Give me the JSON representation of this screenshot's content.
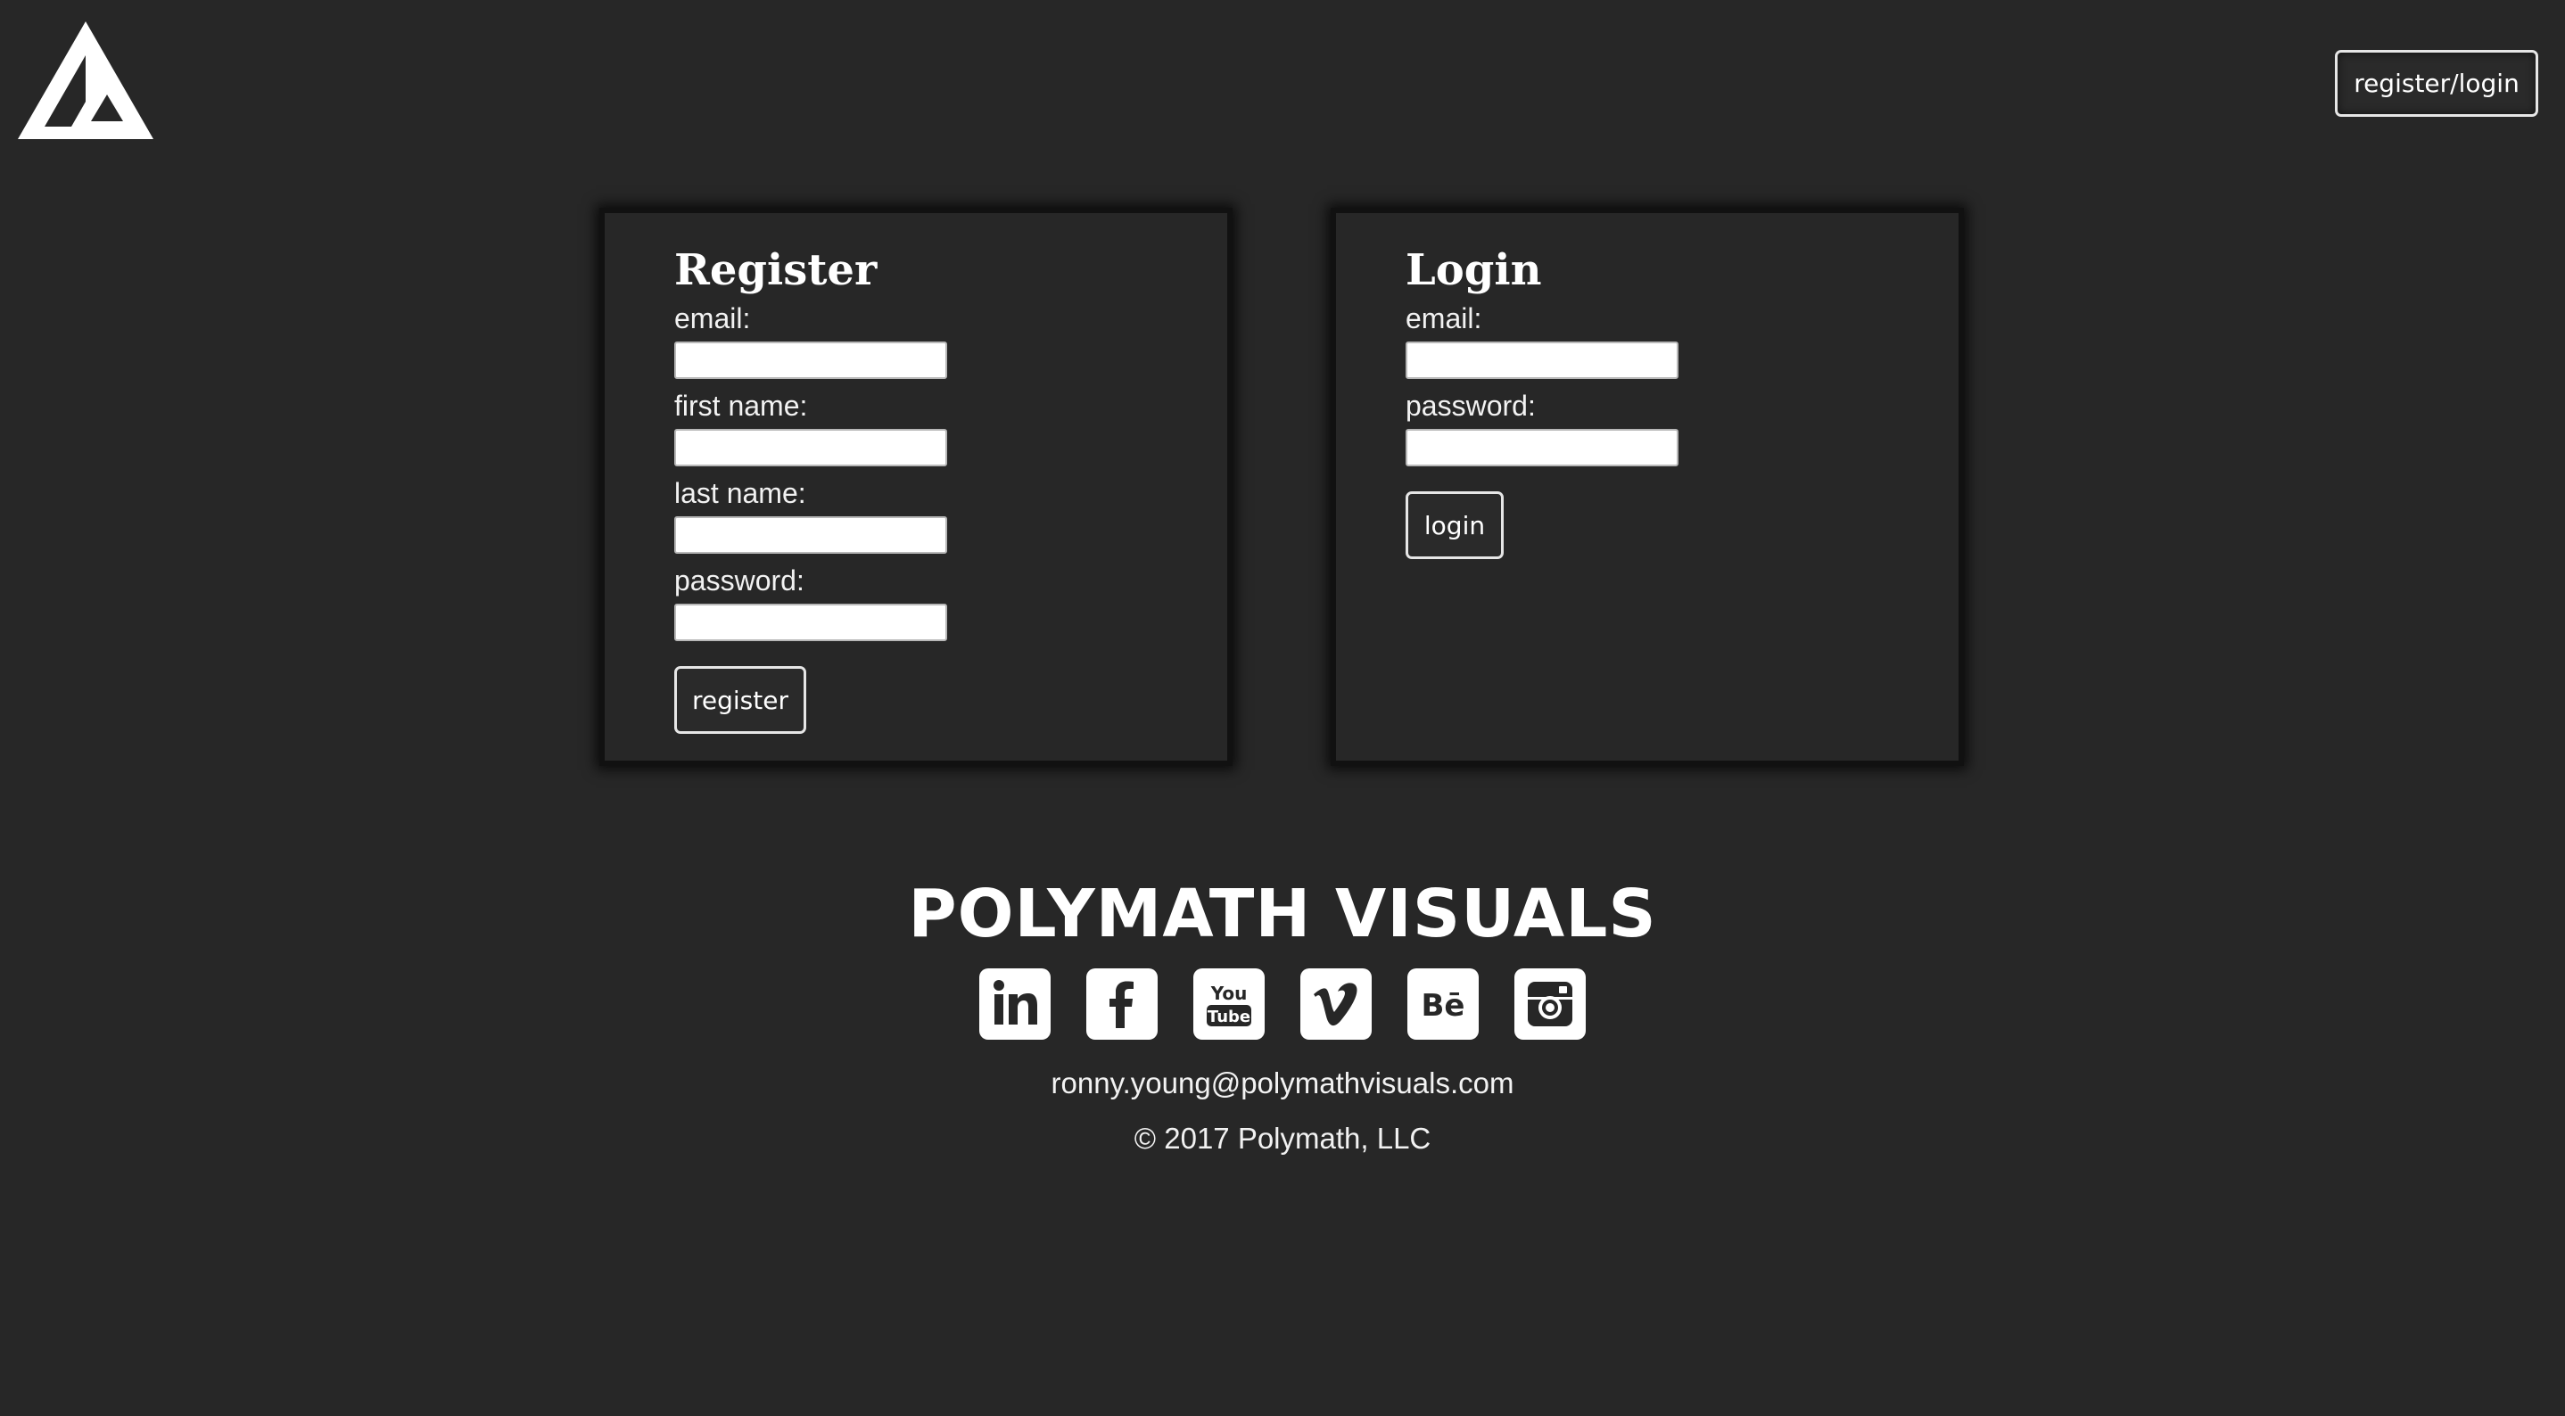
{
  "header": {
    "logo_icon": "polymath-triangle-logo",
    "nav_button_label": "register/login"
  },
  "register": {
    "title": "Register",
    "fields": [
      {
        "label": "email:",
        "value": "",
        "placeholder": ""
      },
      {
        "label": "first name:",
        "value": "",
        "placeholder": ""
      },
      {
        "label": "last name:",
        "value": "",
        "placeholder": ""
      },
      {
        "label": "password:",
        "value": "",
        "placeholder": ""
      }
    ],
    "button_label": "register"
  },
  "login": {
    "title": "Login",
    "fields": [
      {
        "label": "email:",
        "value": "",
        "placeholder": ""
      },
      {
        "label": "password:",
        "value": "",
        "placeholder": ""
      }
    ],
    "button_label": "login"
  },
  "footer": {
    "brand": "POLYMATH VISUALS",
    "socials": [
      {
        "icon": "linkedin-icon"
      },
      {
        "icon": "facebook-icon"
      },
      {
        "icon": "youtube-icon",
        "text_top": "You",
        "text_bottom": "Tube"
      },
      {
        "icon": "vimeo-icon"
      },
      {
        "icon": "behance-icon",
        "text": "Bē"
      },
      {
        "icon": "instagram-icon"
      }
    ],
    "email": "ronny.young@polymathvisuals.com",
    "copyright": "© 2017 Polymath, LLC"
  },
  "colors": {
    "background": "#272727",
    "panel_border": "#111111",
    "text": "#ffffff",
    "input_bg": "#ffffff"
  }
}
